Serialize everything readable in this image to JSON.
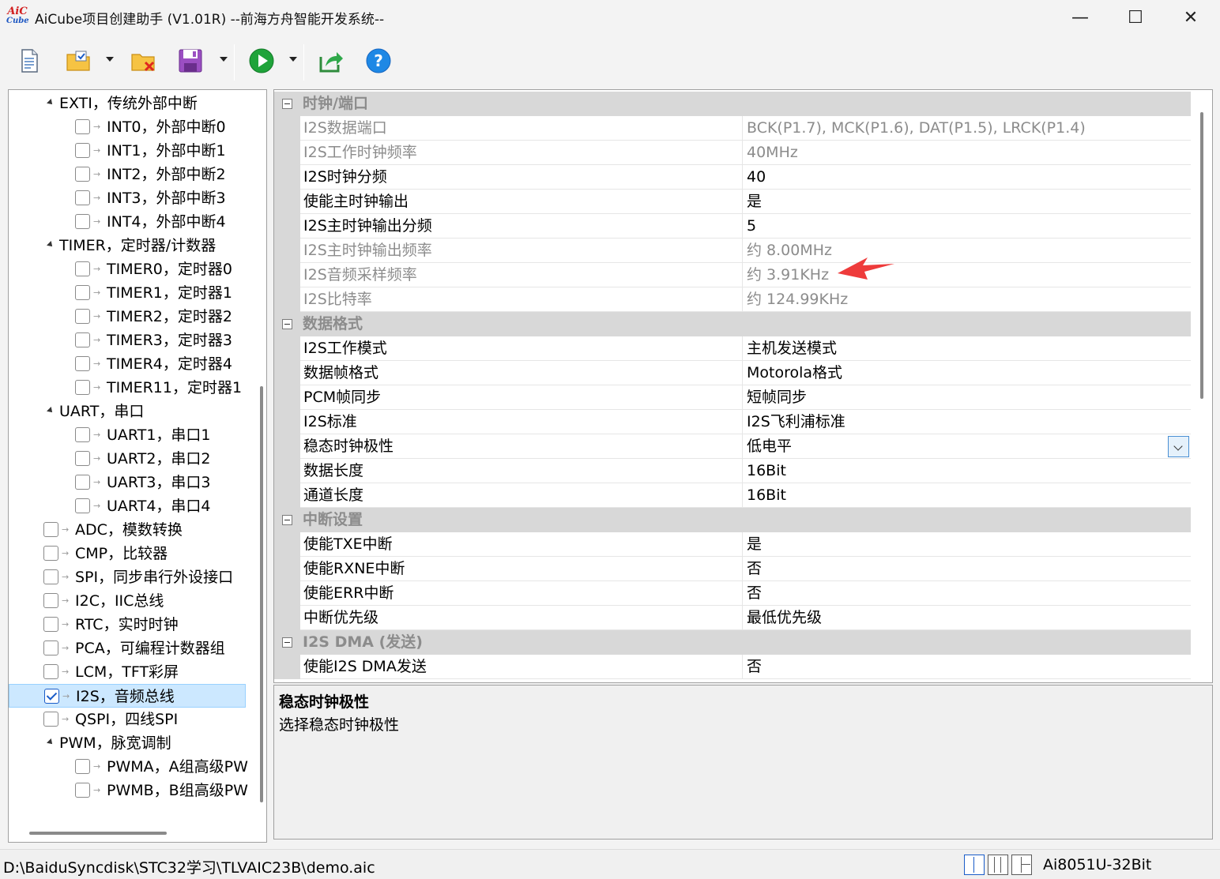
{
  "window": {
    "logo_top": "AiC",
    "logo_bottom": "Cube",
    "title": "AiCube项目创建助手 (V1.01R) --前海方舟智能开发系统--",
    "minimize_glyph": "—",
    "maximize_glyph": "☐",
    "close_glyph": "✕"
  },
  "toolbar": {
    "items": [
      "new-file-icon",
      "open-project-icon",
      "close-project-icon",
      "save-icon",
      "run-icon",
      "export-icon",
      "help-icon"
    ],
    "help_glyph": "?"
  },
  "tree": {
    "items": [
      {
        "label": "EXTI，传统外部中断",
        "type": "group"
      },
      {
        "label": "INT0，外部中断0",
        "type": "item",
        "checked": false
      },
      {
        "label": "INT1，外部中断1",
        "type": "item",
        "checked": false
      },
      {
        "label": "INT2，外部中断2",
        "type": "item",
        "checked": false
      },
      {
        "label": "INT3，外部中断3",
        "type": "item",
        "checked": false
      },
      {
        "label": "INT4，外部中断4",
        "type": "item",
        "checked": false
      },
      {
        "label": "TIMER，定时器/计数器",
        "type": "group"
      },
      {
        "label": "TIMER0，定时器0",
        "type": "item",
        "checked": false
      },
      {
        "label": "TIMER1，定时器1",
        "type": "item",
        "checked": false
      },
      {
        "label": "TIMER2，定时器2",
        "type": "item",
        "checked": false
      },
      {
        "label": "TIMER3，定时器3",
        "type": "item",
        "checked": false
      },
      {
        "label": "TIMER4，定时器4",
        "type": "item",
        "checked": false
      },
      {
        "label": "TIMER11，定时器1",
        "type": "item",
        "checked": false
      },
      {
        "label": "UART，串口",
        "type": "group"
      },
      {
        "label": "UART1，串口1",
        "type": "item",
        "checked": false
      },
      {
        "label": "UART2，串口2",
        "type": "item",
        "checked": false
      },
      {
        "label": "UART3，串口3",
        "type": "item",
        "checked": false
      },
      {
        "label": "UART4，串口4",
        "type": "item",
        "checked": false
      },
      {
        "label": "ADC，模数转换",
        "type": "root",
        "checked": false
      },
      {
        "label": "CMP，比较器",
        "type": "root",
        "checked": false
      },
      {
        "label": "SPI，同步串行外设接口",
        "type": "root",
        "checked": false
      },
      {
        "label": "I2C，IIC总线",
        "type": "root",
        "checked": false
      },
      {
        "label": "RTC，实时时钟",
        "type": "root",
        "checked": false
      },
      {
        "label": "PCA，可编程计数器组",
        "type": "root",
        "checked": false
      },
      {
        "label": "LCM，TFT彩屏",
        "type": "root",
        "checked": false
      },
      {
        "label": "I2S，音频总线",
        "type": "root",
        "checked": true,
        "selected": true
      },
      {
        "label": "QSPI，四线SPI",
        "type": "root",
        "checked": false
      },
      {
        "label": "PWM，脉宽调制",
        "type": "group0"
      },
      {
        "label": "PWMA，A组高级PW",
        "type": "item",
        "checked": false
      },
      {
        "label": "PWMB，B组高级PW",
        "type": "item",
        "checked": false
      }
    ]
  },
  "properties": {
    "rows": [
      {
        "kind": "category",
        "name": "时钟/端口"
      },
      {
        "kind": "prop",
        "name": "I2S数据端口",
        "value": "BCK(P1.7), MCK(P1.6), DAT(P1.5), LRCK(P1.4)",
        "readonly": true
      },
      {
        "kind": "prop",
        "name": "I2S工作时钟频率",
        "value": "40MHz",
        "readonly": true
      },
      {
        "kind": "prop",
        "name": "I2S时钟分频",
        "value": "40",
        "readonly": false
      },
      {
        "kind": "prop",
        "name": "使能主时钟输出",
        "value": "是",
        "readonly": false
      },
      {
        "kind": "prop",
        "name": "I2S主时钟输出分频",
        "value": "5",
        "readonly": false
      },
      {
        "kind": "prop",
        "name": "I2S主时钟输出频率",
        "value": "约 8.00MHz",
        "readonly": true
      },
      {
        "kind": "prop",
        "name": "I2S音频采样频率",
        "value": "约 3.91KHz",
        "readonly": true,
        "annotated": true
      },
      {
        "kind": "prop",
        "name": "I2S比特率",
        "value": "约 124.99KHz",
        "readonly": true
      },
      {
        "kind": "category",
        "name": "数据格式"
      },
      {
        "kind": "prop",
        "name": "I2S工作模式",
        "value": "主机发送模式",
        "readonly": false
      },
      {
        "kind": "prop",
        "name": "数据帧格式",
        "value": "Motorola格式",
        "readonly": false
      },
      {
        "kind": "prop",
        "name": "PCM帧同步",
        "value": "短帧同步",
        "readonly": false
      },
      {
        "kind": "prop",
        "name": "I2S标准",
        "value": "I2S飞利浦标准",
        "readonly": false
      },
      {
        "kind": "prop",
        "name": "稳态时钟极性",
        "value": "低电平",
        "readonly": false,
        "dropdown": true
      },
      {
        "kind": "prop",
        "name": "数据长度",
        "value": "16Bit",
        "readonly": false
      },
      {
        "kind": "prop",
        "name": "通道长度",
        "value": "16Bit",
        "readonly": false
      },
      {
        "kind": "category",
        "name": "中断设置"
      },
      {
        "kind": "prop",
        "name": "使能TXE中断",
        "value": "是",
        "readonly": false
      },
      {
        "kind": "prop",
        "name": "使能RXNE中断",
        "value": "否",
        "readonly": false
      },
      {
        "kind": "prop",
        "name": "使能ERR中断",
        "value": "否",
        "readonly": false
      },
      {
        "kind": "prop",
        "name": "中断优先级",
        "value": "最低优先级",
        "readonly": false
      },
      {
        "kind": "category",
        "name": "I2S DMA (发送)"
      },
      {
        "kind": "prop",
        "name": "使能I2S DMA发送",
        "value": "否",
        "readonly": false
      }
    ]
  },
  "help": {
    "title": "稳态时钟极性",
    "description": "选择稳态时钟极性"
  },
  "status": {
    "path": "D:\\BaiduSyncdisk\\STC32学习\\TLVAIC23B\\demo.aic",
    "mcu": "Ai8051U-32Bit"
  },
  "colors": {
    "accent": "#1a5cc8",
    "selection": "#cce8ff",
    "annotation_arrow": "#ee3b3b",
    "category_bg": "#d8d8d8",
    "readonly_text": "#8c8c8c"
  }
}
